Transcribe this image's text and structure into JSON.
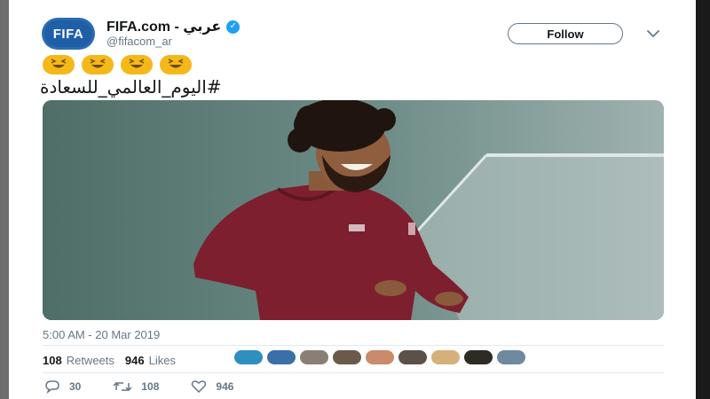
{
  "tweet": {
    "author": {
      "avatar_text": "FIFA",
      "display_name": "FIFA.com - عربي",
      "handle": "@fifacom_ar",
      "verified": true
    },
    "follow_label": "Follow",
    "emojis": [
      "grinning-squinting-face",
      "grinning-squinting-face",
      "grinning-squinting-face",
      "grinning-squinting-face"
    ],
    "text": "#اليوم_العالمي_للسعادة",
    "timestamp": "5:00 AM - 20 Mar 2019",
    "stats": {
      "retweets_count": "108",
      "retweets_label": "Retweets",
      "likes_count": "946",
      "likes_label": "Likes"
    },
    "actions": {
      "reply_count": "30",
      "retweet_count": "108",
      "like_count": "946"
    }
  },
  "colors": {
    "verified": "#1da1f2",
    "muted": "#657786",
    "text": "#14171a",
    "avatar": "#1f5fa8"
  }
}
